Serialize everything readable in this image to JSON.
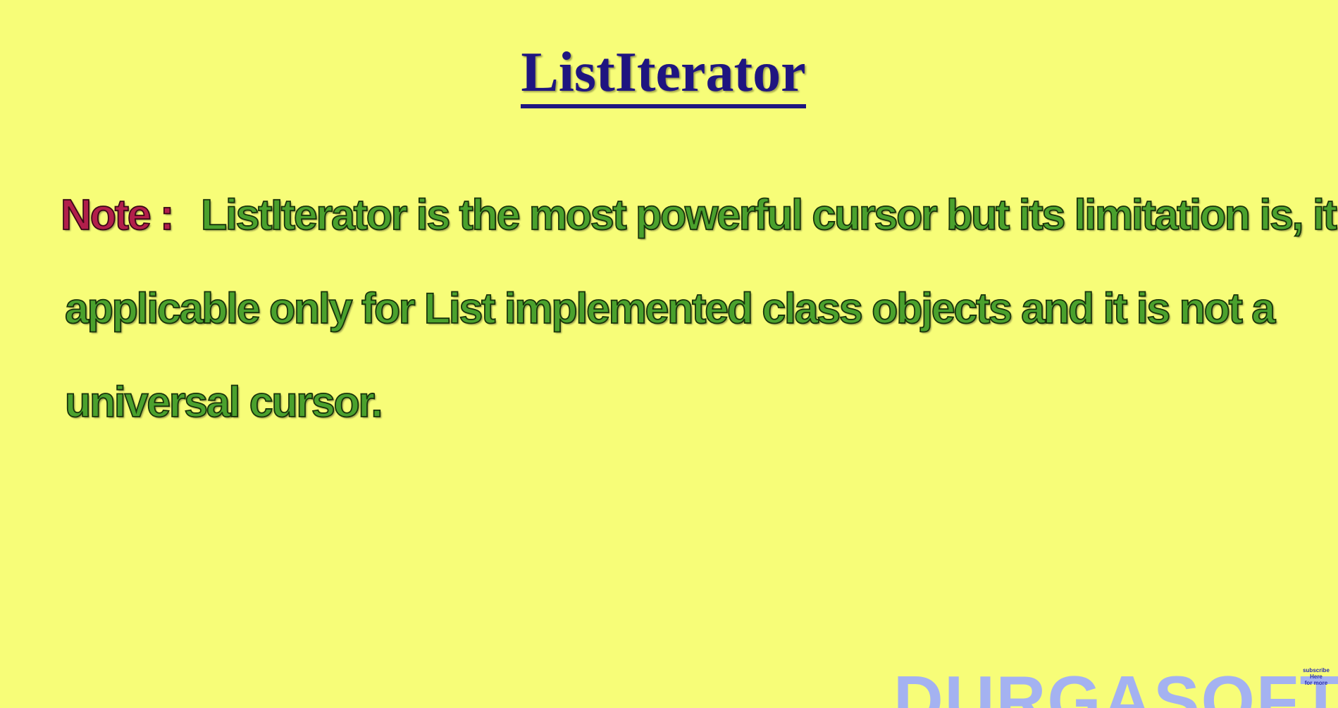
{
  "slide": {
    "title": "ListIterator",
    "note": {
      "label": "Note :",
      "line1": "ListIterator is the most powerful cursor but its limitation is, it is",
      "line2": "applicable only for List implemented class objects and it is not a",
      "line3": "universal cursor."
    },
    "watermark": "DURGASOFT",
    "subscribe": [
      "subscribe",
      "Here",
      "for more"
    ]
  },
  "colors": {
    "background": "#f7fd78",
    "title": "#1f1580",
    "note_label": "#b21f4b",
    "body_text": "#4aa12d",
    "watermark": "#a4b2f1"
  }
}
